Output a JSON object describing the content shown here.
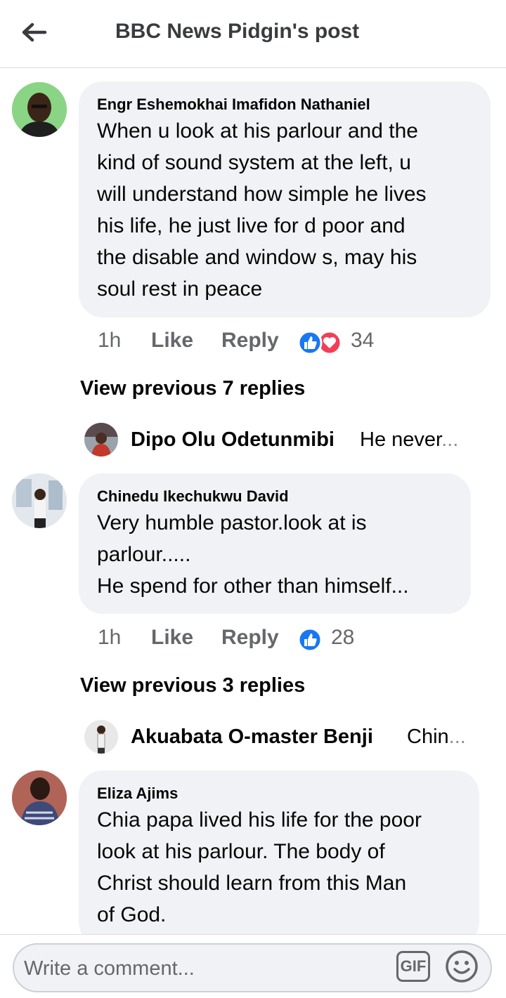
{
  "header": {
    "title": "BBC News Pidgin's post"
  },
  "comments": [
    {
      "author": "Engr Eshemokhai Imafidon Nathaniel",
      "text": "When u look at his parlour and the\nkind of sound system at the left, u\nwill understand how simple he lives\nhis life, he just live for d poor and\nthe disable and window s, may his\nsoul rest in peace",
      "time": "1h",
      "like_label": "Like",
      "reply_label": "Reply",
      "reactions": [
        "like",
        "love"
      ],
      "reaction_count": "34",
      "view_previous": "View previous 7 replies",
      "latest_reply": {
        "author": "Dipo Olu Odetunmibi",
        "snippet": "He never",
        "ellipsis": "..."
      }
    },
    {
      "author": "Chinedu Ikechukwu David",
      "text": "Very humble pastor.look at is\nparlour.....\nHe spend for other than himself...",
      "time": "1h",
      "like_label": "Like",
      "reply_label": "Reply",
      "reactions": [
        "like"
      ],
      "reaction_count": "28",
      "view_previous": "View previous 3 replies",
      "latest_reply": {
        "author": "Akuabata O-master Benji",
        "snippet": "Chin",
        "ellipsis": "..."
      }
    },
    {
      "author": "Eliza Ajims",
      "text": "Chia papa lived his life for the poor\nlook at his parlour. The body of\nChrist should learn from this Man\nof God."
    }
  ],
  "composer": {
    "placeholder": "Write a comment...",
    "gif_label": "GIF"
  },
  "colors": {
    "like_blue": "#1877f2",
    "love_red": "#f33e58",
    "bubble": "#f0f2f5",
    "secondary_text": "#65676b"
  }
}
